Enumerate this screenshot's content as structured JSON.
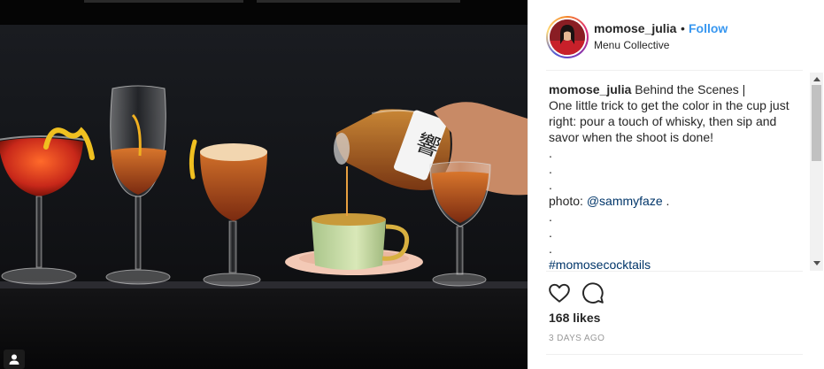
{
  "post": {
    "username": "momose_julia",
    "follow_label": "Follow",
    "separator": "•",
    "location": "Menu Collective",
    "caption": {
      "username": "momose_julia",
      "line1": "Behind the Scenes |",
      "line2": "One little trick to get the color in the cup just right: pour a touch of whisky, then sip and savor when the shoot is done!",
      "dot": ".",
      "photo_prefix": "photo: ",
      "photo_mention": "@sammyfaze",
      "photo_suffix": " .",
      "hashtag": "#momosecocktails"
    },
    "likes": "168 likes",
    "time": "3 days ago"
  },
  "icons": {
    "like": "heart-icon",
    "comment": "comment-icon",
    "tag": "user-tag-icon"
  },
  "colors": {
    "link": "#3897f0",
    "hashtag": "#003569",
    "text": "#262626",
    "muted": "#999999"
  }
}
